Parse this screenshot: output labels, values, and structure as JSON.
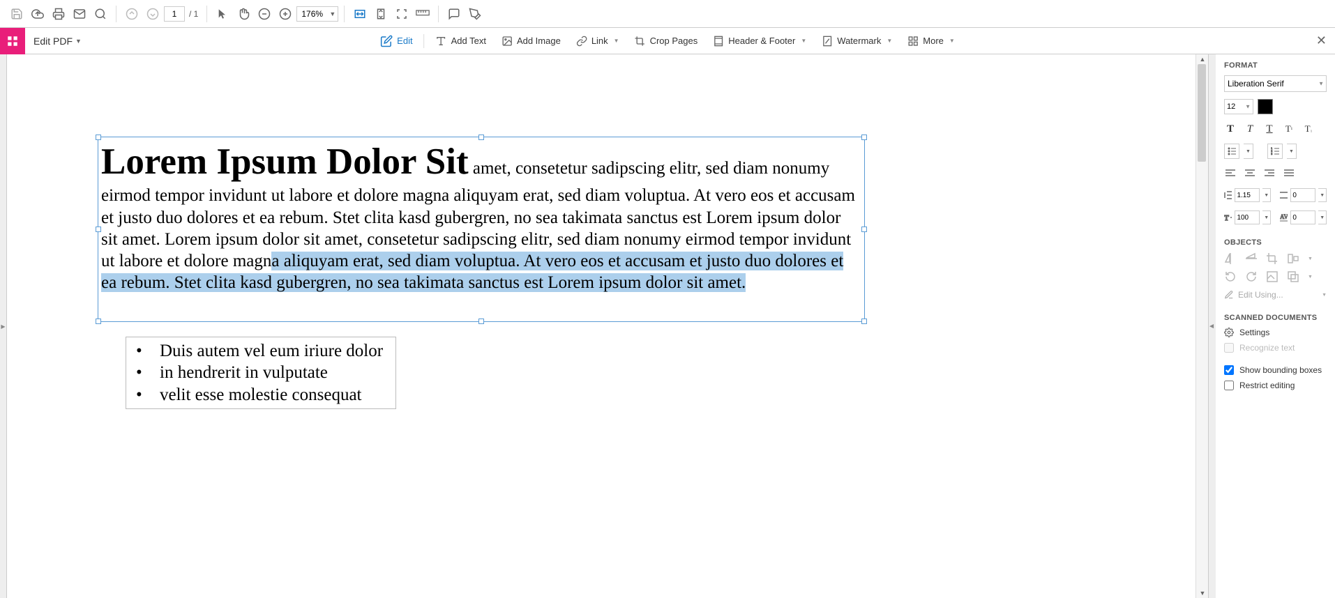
{
  "top_toolbar": {
    "page_current": "1",
    "page_total": "/ 1",
    "zoom": "176%"
  },
  "second_bar": {
    "mode": "Edit PDF",
    "tools": {
      "edit": "Edit",
      "add_text": "Add Text",
      "add_image": "Add Image",
      "link": "Link",
      "crop": "Crop Pages",
      "header_footer": "Header & Footer",
      "watermark": "Watermark",
      "more": "More"
    }
  },
  "document": {
    "title_text": "Lorem Ipsum Dolor Sit",
    "body_part1": " amet, consetetur sadipscing elitr, sed diam nonumy eirmod tempor invidunt ut labore et dolore magna aliquyam erat, sed diam voluptua. At vero eos et accusam et justo duo dolores et ea rebum. Stet clita kasd gubergren, no sea takimata sanctus est Lorem ipsum dolor sit amet. Lorem ipsum dolor sit amet, consetetur sadipscing elitr, sed diam nonumy eirmod tempor invidunt ut labore et dolore magn",
    "body_highlight": "a aliquyam erat, sed diam voluptua. At vero eos et accusam et justo duo dolores et ea rebum. Stet clita kasd gubergren, no sea takimata sanctus est Lorem ipsum dolor sit amet.",
    "bullets": [
      "Duis autem vel eum iriure dolor",
      "in hendrerit in vulputate",
      "velit esse molestie consequat"
    ]
  },
  "panel": {
    "format_heading": "FORMAT",
    "font_name": "Liberation Serif",
    "font_size": "12",
    "line_spacing": "1.15",
    "para_spacing": "0",
    "h_scale": "100",
    "char_spacing": "0",
    "objects_heading": "OBJECTS",
    "edit_using": "Edit Using...",
    "scanned_heading": "SCANNED DOCUMENTS",
    "settings_label": "Settings",
    "recognize_label": "Recognize text",
    "show_boxes": "Show bounding boxes",
    "restrict_label": "Restrict editing"
  }
}
